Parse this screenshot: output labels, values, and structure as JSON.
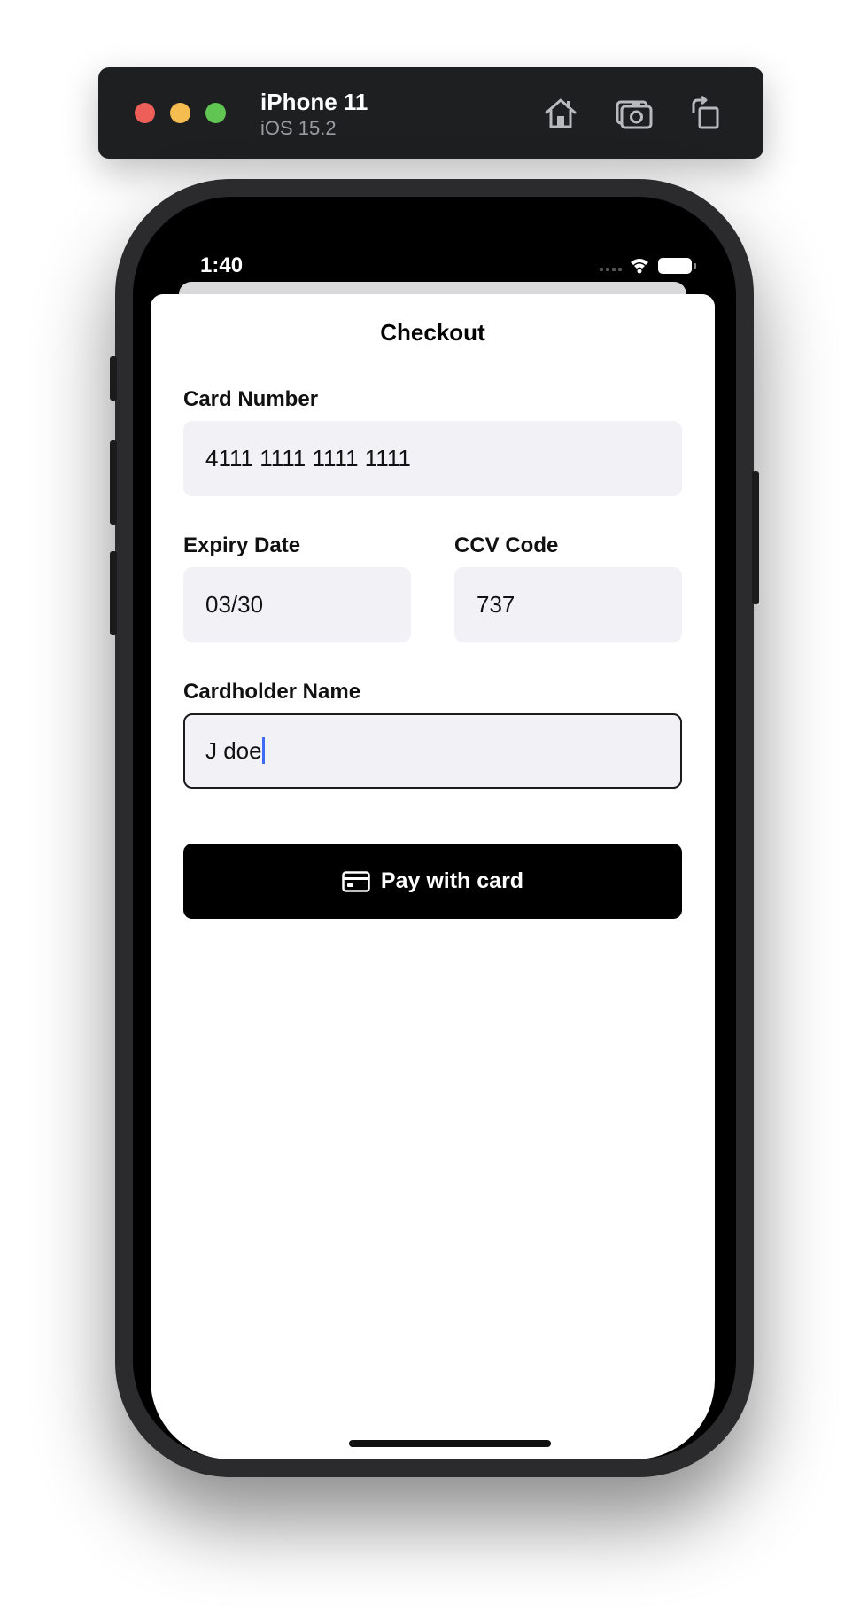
{
  "simulator": {
    "device_name": "iPhone 11",
    "os_version": "iOS 15.2",
    "icons": [
      "home-icon",
      "screenshot-icon",
      "rotate-icon"
    ]
  },
  "status_bar": {
    "time": "1:40"
  },
  "checkout": {
    "title": "Checkout",
    "card_number_label": "Card Number",
    "card_number_value": "4111 1111 1111 1111",
    "expiry_label": "Expiry Date",
    "expiry_value": "03/30",
    "ccv_label": "CCV Code",
    "ccv_value": "737",
    "cardholder_label": "Cardholder Name",
    "cardholder_value": "J doe",
    "pay_button_label": "Pay with card"
  },
  "colors": {
    "field_background": "#f2f2f6",
    "button_background": "#000000",
    "caret": "#3d6bf5"
  }
}
